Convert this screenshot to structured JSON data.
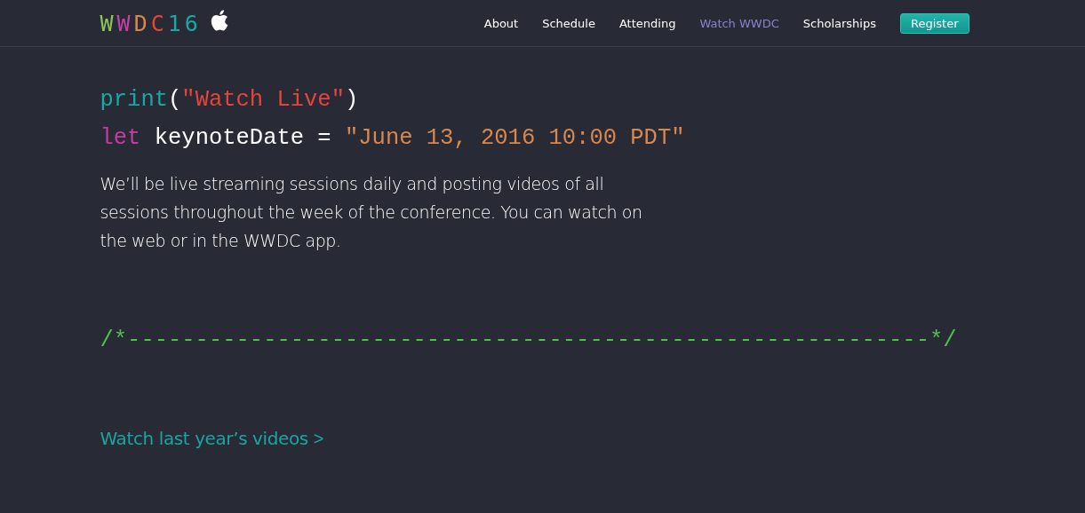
{
  "logo": [
    {
      "text": "W",
      "color": "#8dc55a"
    },
    {
      "text": "W",
      "color": "#c044a8"
    },
    {
      "text": "D",
      "color": "#d8884d"
    },
    {
      "text": "C",
      "color": "#e5443d"
    },
    {
      "text": "16",
      "color": "#17a9a3"
    }
  ],
  "nav": [
    {
      "label": "About",
      "selected": false
    },
    {
      "label": "Schedule",
      "selected": false
    },
    {
      "label": "Attending",
      "selected": false
    },
    {
      "label": "Watch WWDC",
      "selected": true
    },
    {
      "label": "Scholarships",
      "selected": false
    }
  ],
  "register_button": "Register",
  "code_lines": [
    [
      {
        "kind": "function",
        "text": "print"
      },
      {
        "kind": "plain",
        "text": "("
      },
      {
        "kind": "string-red",
        "text": "\"Watch Live\""
      },
      {
        "kind": "plain",
        "text": ")"
      }
    ],
    [
      {
        "kind": "keyword",
        "text": "let"
      },
      {
        "kind": "plain",
        "text": " keynoteDate = "
      },
      {
        "kind": "string",
        "text": "\"June 13, 2016 10:00 PDT\""
      }
    ]
  ],
  "intro": "We’ll be live streaming sessions daily and posting videos of all sessions throughout the week of the conference. You can watch on the web or in the WWDC app.",
  "divider": "/*-----------------------------------------------------------*/",
  "videos_link": "Watch last year’s videos",
  "videos_link_arrow": ">"
}
